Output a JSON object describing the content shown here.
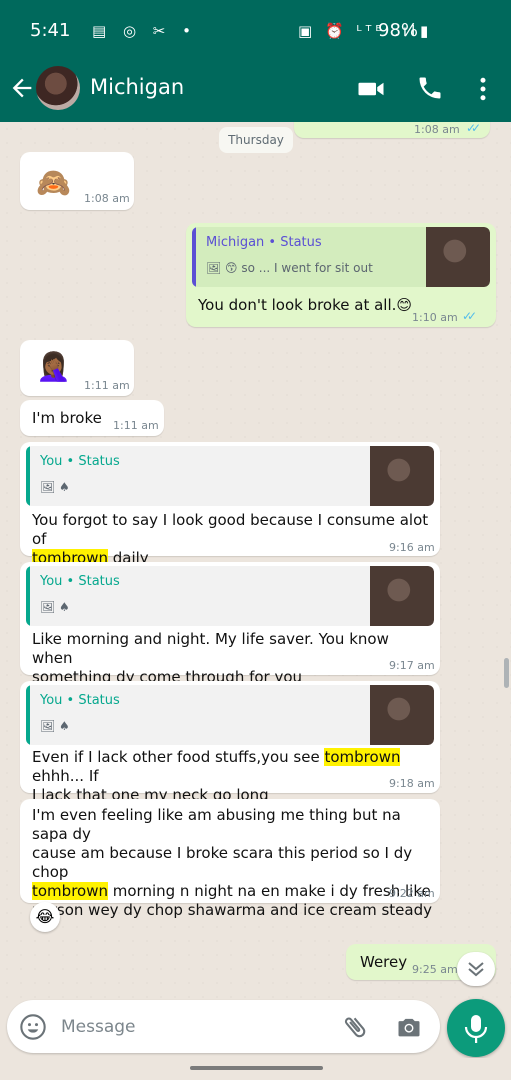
{
  "status_bar": {
    "time": "5:41",
    "icons_left": "▤ ◎ ✂ •",
    "icons_right": "▣ ⏰ ᴸᵀᴱ .ıl",
    "battery": "98%"
  },
  "header": {
    "contact_name": "Michigan"
  },
  "chat": {
    "prev_time": "1:08 am",
    "date_label": "Thursday",
    "messages": [
      {
        "emoji": "🙈",
        "time": "1:08 am"
      },
      {
        "quote_title": "Michigan • Status",
        "quote_text": "🖼 😙 so ... I went for sit out",
        "text": "You don't look broke at all.😊",
        "time": "1:10 am"
      },
      {
        "emoji": "🤦🏾‍♀️",
        "time": "1:11 am"
      },
      {
        "text": "I'm broke",
        "time": "1:11 am"
      },
      {
        "quote_title": "You • Status",
        "quote_text": "🖼 ♠",
        "text_a": "You forgot to say I look good because I consume alot of",
        "highlight": "tombrown",
        "text_b": " daily",
        "time": "9:16 am"
      },
      {
        "quote_title": "You • Status",
        "quote_text": "🖼 ♠",
        "text_a": "Like morning and night. My life saver. You know when",
        "text_b": "something dy come through for you",
        "time": "9:17 am"
      },
      {
        "quote_title": "You • Status",
        "quote_text": "🖼 ♠",
        "text_a": "Even if I lack other food stuffs,you see ",
        "highlight": "tombrown",
        "text_b": " ehhh... If",
        "text_c": "I lack that one my neck go long",
        "time": "9:18 am"
      },
      {
        "text_a": "I'm even feeling like am abusing me thing but na sapa dy",
        "text_b": "cause am because I broke scara this period so I dy chop",
        "highlight": "tombrown",
        "text_c": " morning n night na en make i dy fresh like",
        "text_d": "person wey dy chop shawarma and ice cream steady",
        "time": "9:22 am",
        "reaction": "😂"
      },
      {
        "text": "Werey",
        "time": "9:25 am"
      }
    ]
  },
  "composer": {
    "placeholder": "Message"
  },
  "colors": {
    "header": "#00695c",
    "outgoing_bubble": "#e2f7cb",
    "incoming_bubble": "#ffffff",
    "mic_button": "#0c9b7b",
    "highlight": "#fff200",
    "read_ticks": "#53bdeb"
  },
  "icons": [
    "back-arrow-icon",
    "video-call-icon",
    "phone-icon",
    "more-vert-icon",
    "emoji-icon",
    "attach-icon",
    "camera-icon",
    "mic-icon",
    "chevron-down-icon"
  ]
}
